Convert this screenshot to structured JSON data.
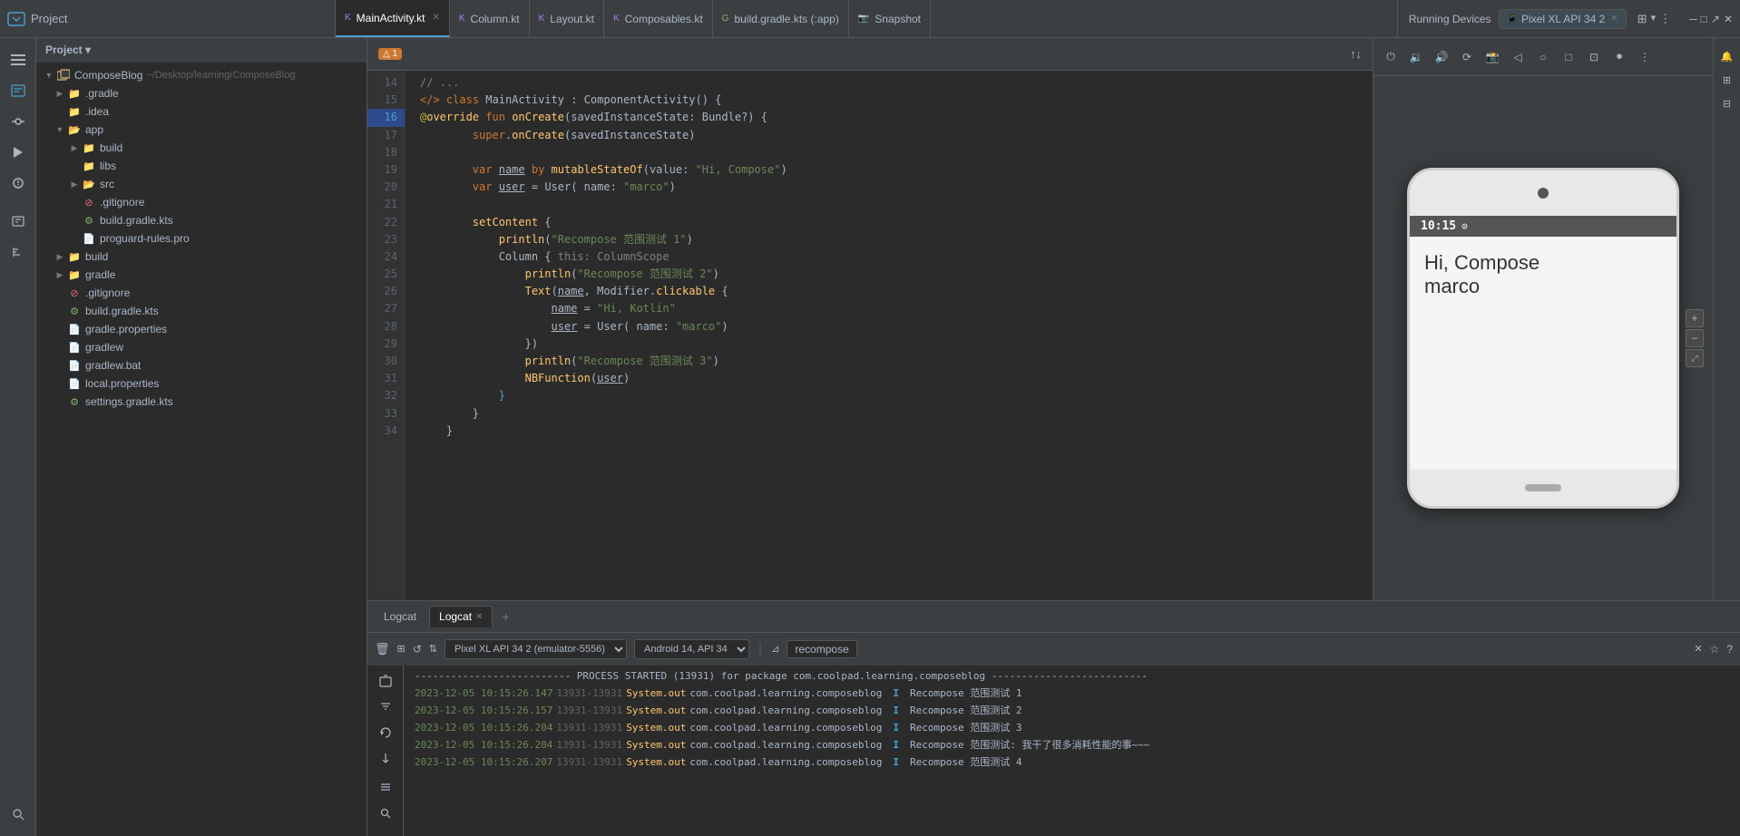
{
  "topbar": {
    "project_icon": "A",
    "project_label": "Project",
    "tabs": [
      {
        "label": "MainActivity.kt",
        "active": true,
        "closeable": true,
        "icon": "kt"
      },
      {
        "label": "Column.kt",
        "active": false,
        "closeable": false,
        "icon": "kt"
      },
      {
        "label": "Layout.kt",
        "active": false,
        "closeable": false,
        "icon": "kt"
      },
      {
        "label": "Composables.kt",
        "active": false,
        "closeable": false,
        "icon": "kt"
      },
      {
        "label": "build.gradle.kts (:app)",
        "active": false,
        "closeable": false,
        "icon": "gr"
      },
      {
        "label": "Snapshot",
        "active": false,
        "closeable": false,
        "icon": "cam"
      }
    ],
    "running_devices_label": "Running Devices",
    "device_tab_label": "Pixel XL API 34 2",
    "device_tab_closeable": true
  },
  "project_panel": {
    "header": "Project",
    "tree": [
      {
        "level": 0,
        "label": "ComposeBlog",
        "sublabel": "~/Desktop/learning/ComposeBlog",
        "expanded": true,
        "type": "project",
        "has_arrow": true
      },
      {
        "level": 1,
        "label": ".gradle",
        "expanded": false,
        "type": "folder",
        "has_arrow": true
      },
      {
        "level": 1,
        "label": ".idea",
        "expanded": false,
        "type": "folder",
        "has_arrow": false
      },
      {
        "level": 1,
        "label": "app",
        "expanded": true,
        "type": "folder",
        "has_arrow": true
      },
      {
        "level": 2,
        "label": "build",
        "expanded": false,
        "type": "folder",
        "has_arrow": true
      },
      {
        "level": 2,
        "label": "libs",
        "expanded": false,
        "type": "folder",
        "has_arrow": false
      },
      {
        "level": 2,
        "label": "src",
        "expanded": false,
        "type": "folder",
        "has_arrow": true
      },
      {
        "level": 2,
        "label": ".gitignore",
        "expanded": false,
        "type": "git"
      },
      {
        "level": 2,
        "label": "build.gradle.kts",
        "expanded": false,
        "type": "gradle"
      },
      {
        "level": 2,
        "label": "proguard-rules.pro",
        "expanded": false,
        "type": "file"
      },
      {
        "level": 1,
        "label": "build",
        "expanded": false,
        "type": "folder",
        "has_arrow": true
      },
      {
        "level": 1,
        "label": "gradle",
        "expanded": false,
        "type": "folder",
        "has_arrow": true
      },
      {
        "level": 2,
        "label": ".gitignore",
        "expanded": false,
        "type": "git"
      },
      {
        "level": 2,
        "label": "build.gradle.kts",
        "expanded": false,
        "type": "gradle"
      },
      {
        "level": 2,
        "label": "gradle.properties",
        "expanded": false,
        "type": "file"
      },
      {
        "level": 2,
        "label": "gradlew",
        "expanded": false,
        "type": "file"
      },
      {
        "level": 2,
        "label": "gradlew.bat",
        "expanded": false,
        "type": "file"
      },
      {
        "level": 2,
        "label": "local.properties",
        "expanded": false,
        "type": "file"
      },
      {
        "level": 2,
        "label": "settings.gradle.kts",
        "expanded": false,
        "type": "gradle"
      }
    ]
  },
  "editor": {
    "filename": "MainActivity.kt",
    "lines": [
      {
        "num": 14,
        "code": ""
      },
      {
        "num": 15,
        "code": "class MainActivity : ComponentActivity() {"
      },
      {
        "num": 16,
        "code": "    override fun onCreate(savedInstanceState: Bundle?) {"
      },
      {
        "num": 17,
        "code": "        super.onCreate(savedInstanceState)"
      },
      {
        "num": 18,
        "code": ""
      },
      {
        "num": 19,
        "code": "        var name by mutableStateOf( value: \"Hi, Compose\")"
      },
      {
        "num": 20,
        "code": "        var user = User( name: \"marco\")"
      },
      {
        "num": 21,
        "code": ""
      },
      {
        "num": 22,
        "code": "        setContent {"
      },
      {
        "num": 23,
        "code": "            println(\"Recompose 范围测试 1\")"
      },
      {
        "num": 24,
        "code": "            Column { this: ColumnScope"
      },
      {
        "num": 25,
        "code": "                println(\"Recompose 范围测试 2\")"
      },
      {
        "num": 26,
        "code": "                Text(name, Modifier.clickable {"
      },
      {
        "num": 27,
        "code": "                    name = \"Hi, Kotlin\""
      },
      {
        "num": 28,
        "code": "                    user = User( name: \"marco\")"
      },
      {
        "num": 29,
        "code": "                })"
      },
      {
        "num": 30,
        "code": "                println(\"Recompose 范围测试 3\")"
      },
      {
        "num": 31,
        "code": "                NBFunction(user)"
      },
      {
        "num": 32,
        "code": "            }"
      },
      {
        "num": 33,
        "code": "        }"
      },
      {
        "num": 34,
        "code": "    }"
      }
    ],
    "warning_count": 1
  },
  "device_preview": {
    "phone_time": "10:15",
    "phone_clock_icon": "⊙",
    "phone_content_line1": "Hi, Compose",
    "phone_content_line2": "marco"
  },
  "logcat": {
    "tabs": [
      {
        "label": "Logcat",
        "active": true,
        "closeable": false
      },
      {
        "label": "Logcat",
        "active": false,
        "closeable": true
      }
    ],
    "device_selector": "Pixel XL API 34 2 (emulator-5556)",
    "api_selector": "Android 14, API 34",
    "filter": "recompose",
    "log_entries": [
      {
        "timestamp": "2023-12-05",
        "time": "10:15:26.147",
        "pid": "13931-13931",
        "tag": "System.out",
        "pkg": "com.coolpad.learning.composeblog",
        "level": "I",
        "msg": "Recompose 范围测试 1"
      },
      {
        "timestamp": "2023-12-05",
        "time": "10:15:26.157",
        "pid": "13931-13931",
        "tag": "System.out",
        "pkg": "com.coolpad.learning.composeblog",
        "level": "I",
        "msg": "Recompose 范围测试 2"
      },
      {
        "timestamp": "2023-12-05",
        "time": "10:15:26.204",
        "pid": "13931-13931",
        "tag": "System.out",
        "pkg": "com.coolpad.learning.composeblog",
        "level": "I",
        "msg": "Recompose 范围测试 3"
      },
      {
        "timestamp": "2023-12-05",
        "time": "10:15:26.204",
        "pid": "13931-13931",
        "tag": "System.out",
        "pkg": "com.coolpad.learning.composeblog",
        "level": "I",
        "msg": "Recompose 范围测试: 我干了很多消耗性能的事~~~"
      },
      {
        "timestamp": "2023-12-05",
        "time": "10:15:26.207",
        "pid": "13931-13931",
        "tag": "System.out",
        "pkg": "com.coolpad.learning.composeblog",
        "level": "I",
        "msg": "Recompose 范围测试 4"
      }
    ],
    "process_line": "-------------------------- PROCESS STARTED (13931) for package com.coolpad.learning.composeblog --------------------------"
  },
  "left_sidebar_icons": [
    "≡",
    "◉",
    "⊞",
    "↺",
    "↕",
    "✦",
    "⊟",
    "⊕",
    "⚙"
  ],
  "right_sidebar_icons": [
    "□",
    "◫",
    "⊞"
  ]
}
